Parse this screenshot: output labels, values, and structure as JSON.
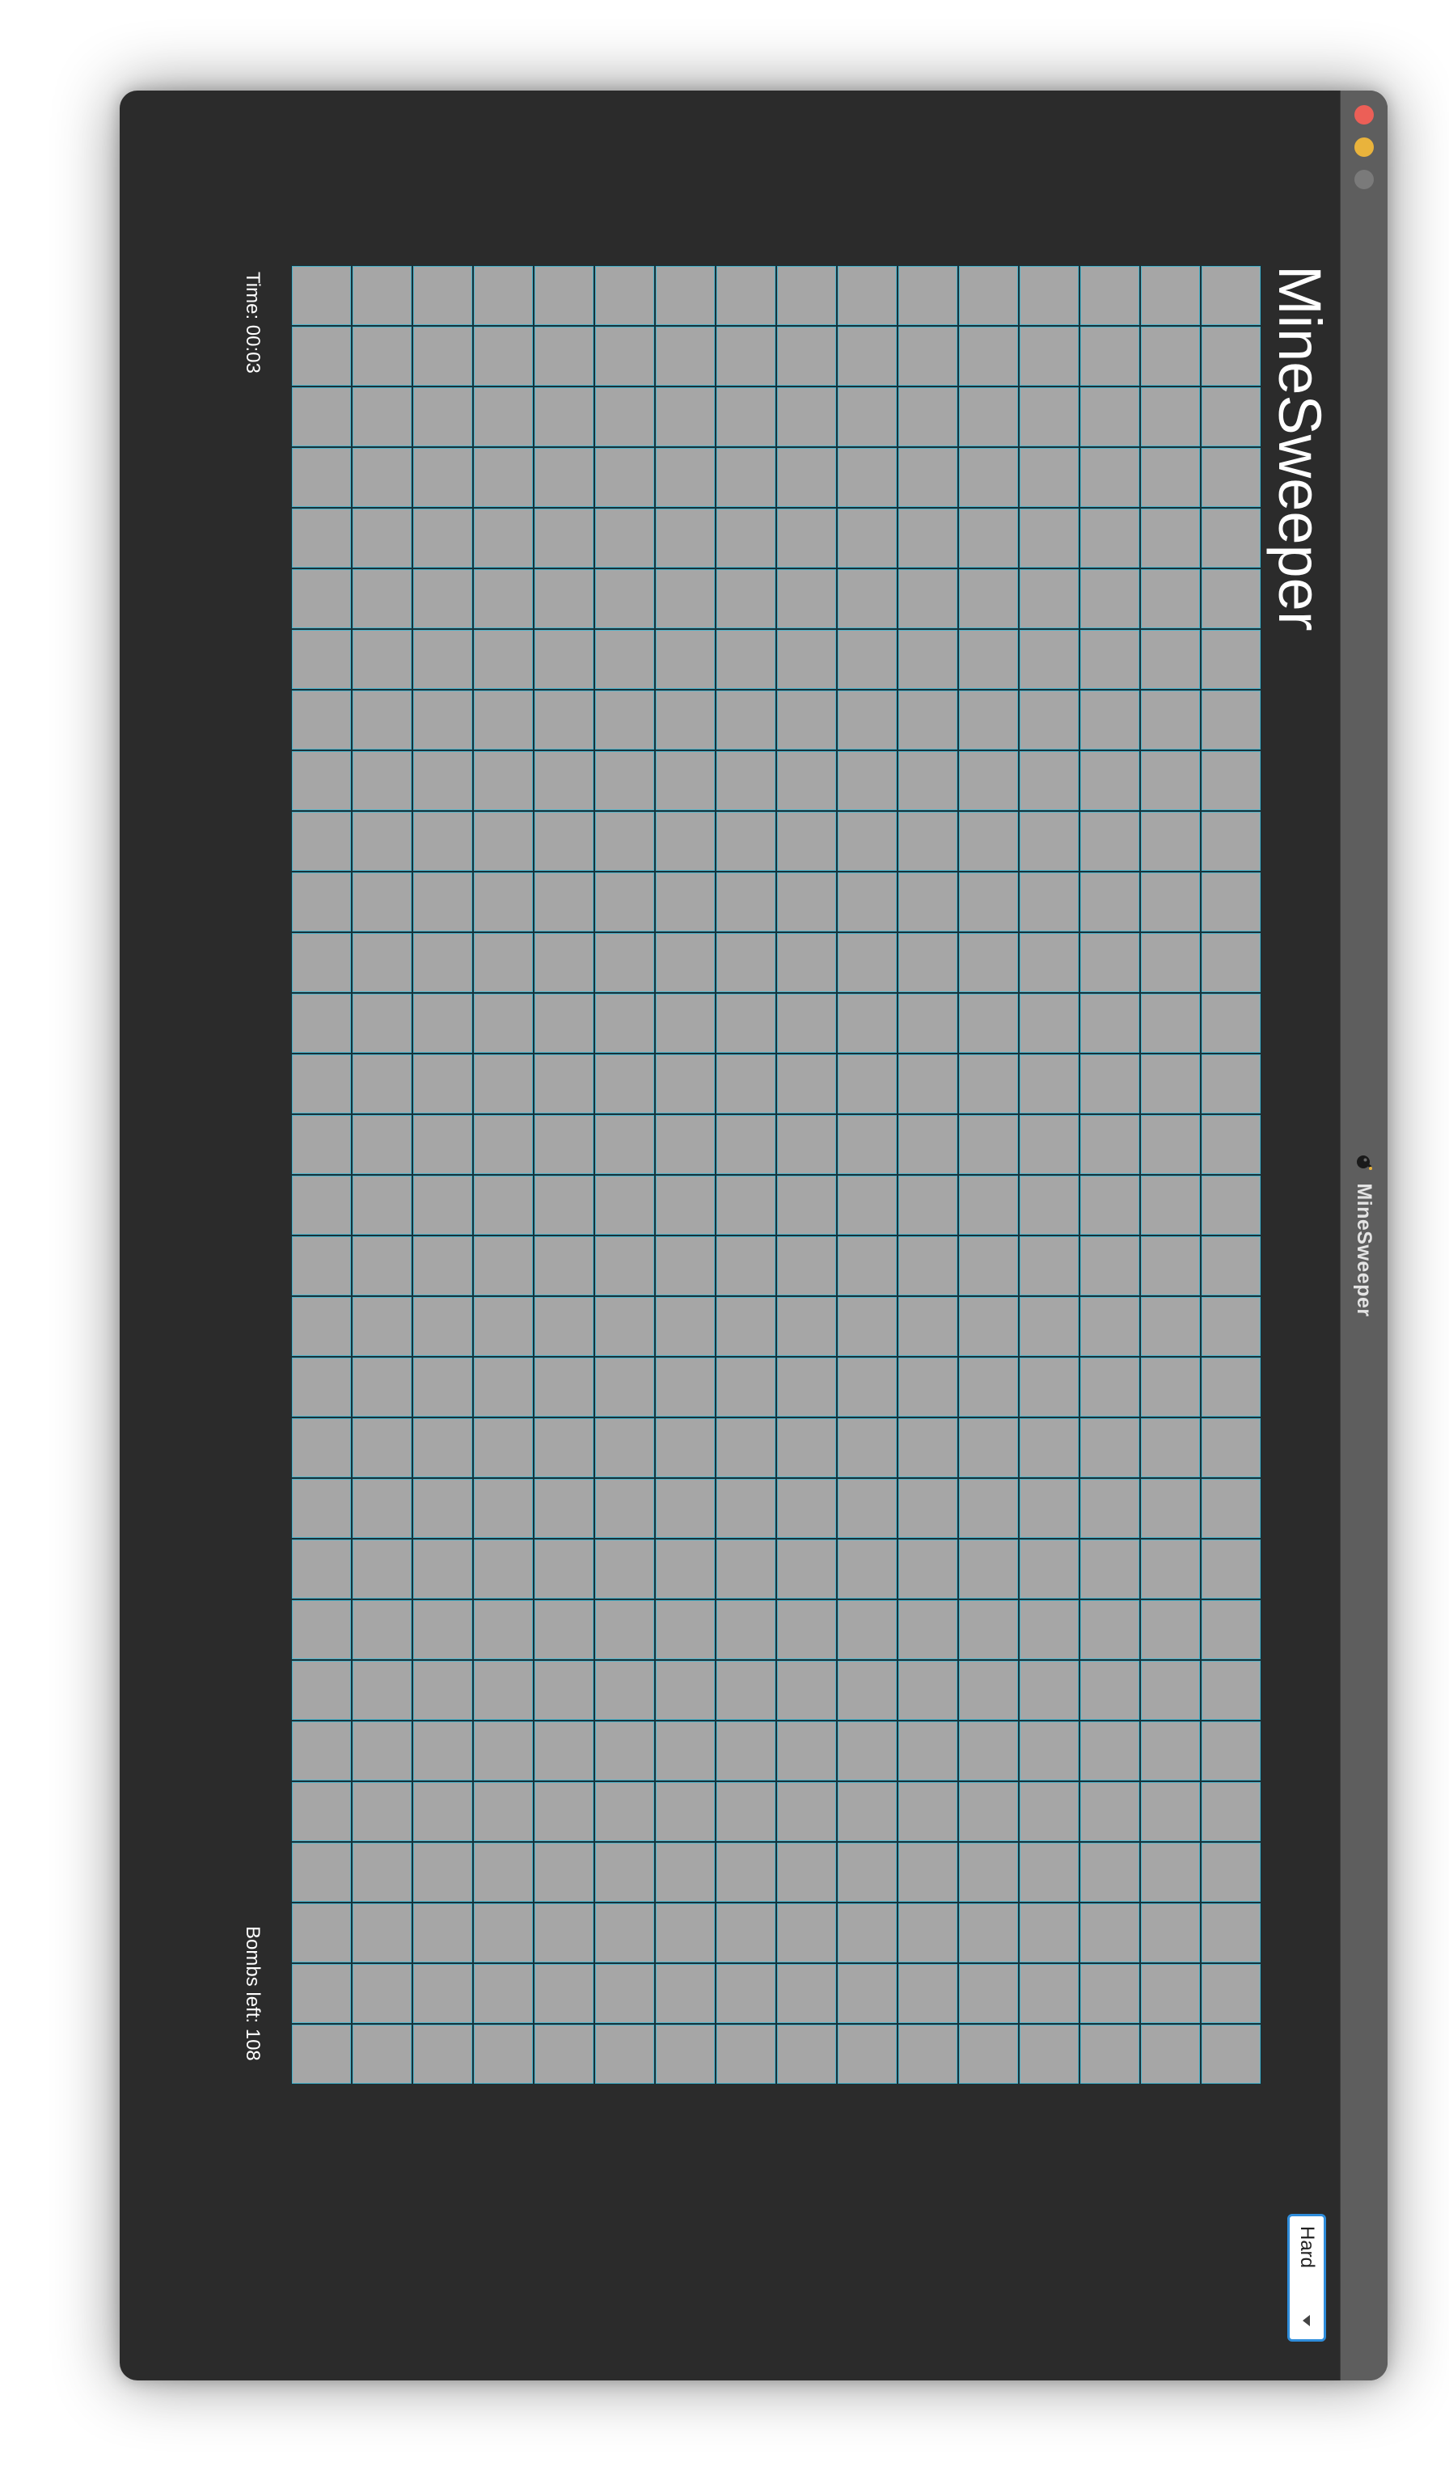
{
  "window": {
    "title": "MineSweeper",
    "app_icon": "bomb-icon"
  },
  "game": {
    "title": "MineSweeper",
    "difficulty": {
      "selected": "Hard"
    },
    "timer_text": "Time: 00:03",
    "bombs_left_text": "Bombs left: 108",
    "board": {
      "rows": 16,
      "cols": 30,
      "cell_state": "covered"
    }
  },
  "colors": {
    "window_bg": "#2b2b2b",
    "title_bar": "#5e5e5e",
    "close": "#ec5f57",
    "minimize": "#e9b33c",
    "zoom": "#7a7a7a",
    "cell_fill": "#a6a6a6",
    "cell_highlight": "#4fb2c8",
    "select_border": "#2f8ddb"
  }
}
